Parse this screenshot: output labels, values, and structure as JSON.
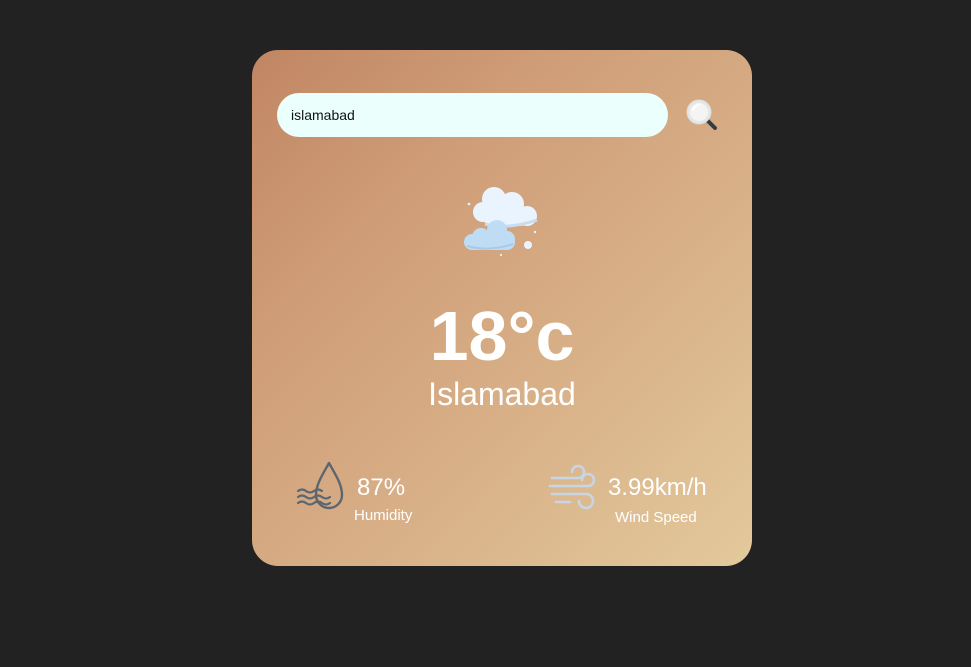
{
  "search": {
    "value": "islamabad",
    "icon": "search-icon"
  },
  "weather": {
    "icon": "clouds-icon",
    "temperature": "18°c",
    "city": "Islamabad"
  },
  "details": {
    "humidity": {
      "icon": "humidity-icon",
      "value": "87%",
      "label": "Humidity"
    },
    "wind": {
      "icon": "wind-icon",
      "value": "3.99km/h",
      "label": "Wind Speed"
    }
  },
  "colors": {
    "page_background": "#222222",
    "card_gradient_start": "#c18664",
    "card_gradient_end": "#e3c99b",
    "search_background": "#ebfffc",
    "text": "#ffffff"
  }
}
